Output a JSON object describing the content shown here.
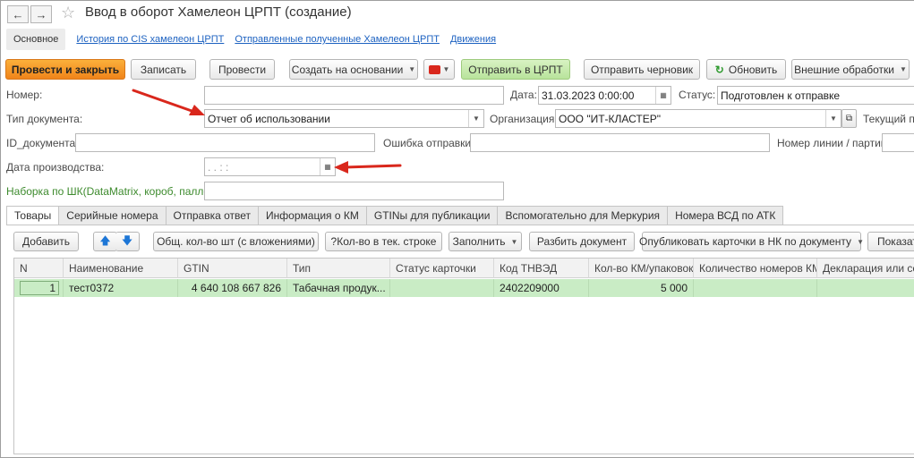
{
  "window": {
    "title": "Ввод в оборот Хамелеон ЦРПТ (создание)"
  },
  "nav": {
    "back": "←",
    "forward": "→",
    "star": "☆"
  },
  "nav_tabs": {
    "main": "Основное",
    "links": [
      "История по CIS хамелеон ЦРПТ",
      "Отправленные полученные Хамелеон ЦРПТ",
      "Движения"
    ]
  },
  "toolbar": {
    "post_close": "Провести и закрыть",
    "save": "Записать",
    "post": "Провести",
    "create_based": "Создать на основании",
    "send": "Отправить в ЦРПТ",
    "send_draft": "Отправить черновик",
    "refresh": "Обновить",
    "external": "Внешние обработки"
  },
  "form": {
    "number_label": "Номер:",
    "number_value": "",
    "date_label": "Дата:",
    "date_value": "31.03.2023  0:00:00",
    "status_label": "Статус:",
    "status_value": "Подготовлен к отправке",
    "doctype_label": "Тип документа:",
    "doctype_value": "Отчет об использовании",
    "org_label": "Организация:",
    "org_value": "ООО \"ИТ-КЛАСТЕР\"",
    "current_label": "Текущий по",
    "id_label": "ID_документа:",
    "id_value": "",
    "error_label": "Ошибка отправки:",
    "error_value": "",
    "line_label": "Номер линии / партии:",
    "proddate_label": "Дата производства:",
    "proddate_value": " .  .      :  :",
    "barcode_label": "Наборка по ШК(DataMatrix, короб, паллет):",
    "barcode_value": ""
  },
  "tabs": [
    "Товары",
    "Серийные номера",
    "Отправка ответ",
    "Информация о КМ",
    "GTINы для публикации",
    "Вспомогательно для Меркурия",
    "Номера ВСД по АТК"
  ],
  "table_toolbar": {
    "add": "Добавить",
    "total_qty": "Общ. кол-во шт (с вложениями)",
    "qty_row": "?Кол-во в тек. строке",
    "fill": "Заполнить",
    "split": "Разбить документ",
    "publish": "Опубликовать карточки в НК по документу",
    "show": "Показат"
  },
  "table": {
    "columns": [
      "N",
      "Наименование",
      "GTIN",
      "Тип",
      "Статус карточки",
      "Код ТНВЭД",
      "Кол-во КМ/упаковок",
      "Количество номеров КМ",
      "Декларация или серт"
    ],
    "rows": [
      {
        "n": "1",
        "name": "тест0372",
        "gtin": "4 640 108 667 826",
        "type": "Табачная продук...",
        "status": "",
        "tnved": "2402209000",
        "qty": "5 000",
        "km_count": "",
        "decl": ""
      }
    ]
  },
  "colors": {
    "accent_orange": "#f0841a",
    "send_green": "#b8e39b",
    "row_selected": "#c9ecc5",
    "arrow_red": "#d9271c",
    "link_blue": "#1d62c1"
  }
}
